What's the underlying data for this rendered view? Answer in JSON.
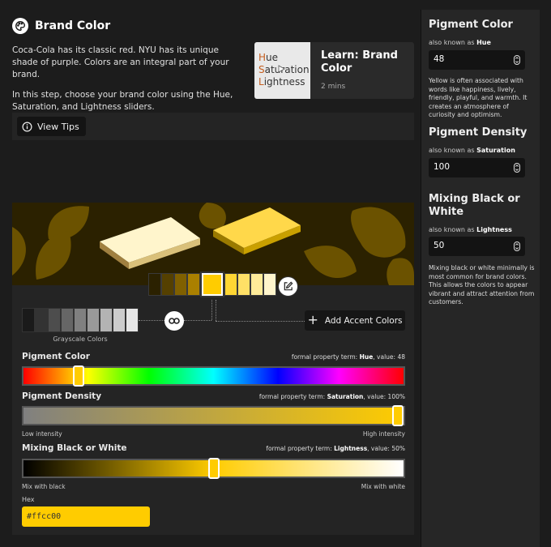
{
  "header": {
    "title": "Brand Color",
    "logo_icon": "palette-icon"
  },
  "intro": {
    "paragraph1": "Coca-Cola has its classic red. NYU has its unique shade of purple. Colors are an integral part of your brand.",
    "paragraph2": "In this step, choose your brand color using the Hue, Saturation, and Lightness sliders."
  },
  "learn_card": {
    "thumb_hue": "Hue",
    "thumb_saturation": "Saturation",
    "thumb_lightness": "Lightness",
    "title": "Learn: Brand Color",
    "duration": "2 mins"
  },
  "tips": {
    "label": "View Tips",
    "icon": "info-icon"
  },
  "colors": {
    "brand": "#ffcc00",
    "banner_bg": "#2b2100",
    "leaf": "#6b5200",
    "shade_swatches": [
      "#2b2100",
      "#554000",
      "#806000",
      "#aa8000",
      "#ffcc00",
      "#ffd633",
      "#ffe066",
      "#ffeb99",
      "#fff5cc"
    ],
    "selected_swatch_index": 4,
    "gray_swatches": [
      "#1a1a1a",
      "#333333",
      "#4d4d4d",
      "#666666",
      "#808080",
      "#999999",
      "#b3b3b3",
      "#cccccc",
      "#e6e6e6"
    ]
  },
  "grayscale_label": "Grayscale Colors",
  "accent_button": {
    "label": "Add Accent Colors"
  },
  "sliders": {
    "hue": {
      "name": "Pigment Color",
      "term_prefix": "formal property term: ",
      "term": "Hue",
      "value_text": ", value: 48",
      "value": 48,
      "max": 360
    },
    "saturation": {
      "name": "Pigment Density",
      "term_prefix": "formal property term: ",
      "term": "Saturation",
      "value_text": ", value: 100%",
      "value": 100,
      "max": 100,
      "low_label": "Low intensity",
      "high_label": "High intensity"
    },
    "lightness": {
      "name": "Mixing Black or White",
      "term_prefix": "formal property term: ",
      "term": "Lightness",
      "value_text": ", value: 50%",
      "value": 50,
      "max": 100,
      "low_label": "Mix with black",
      "high_label": "Mix with white"
    }
  },
  "hex": {
    "label": "Hex",
    "value": "#ffcc00"
  },
  "sidebar": {
    "hue": {
      "title": "Pigment Color",
      "aka_prefix": "also known as ",
      "aka": "Hue",
      "value": "48",
      "desc": "Yellow is often associated with words like happiness, lively, friendly, playful, and warmth. It creates an atmosphere of curiosity and optimism."
    },
    "saturation": {
      "title": "Pigment Density",
      "aka_prefix": "also known as ",
      "aka": "Saturation",
      "value": "100"
    },
    "lightness": {
      "title": "Mixing Black or White",
      "aka_prefix": "also known as ",
      "aka": "Lightness",
      "value": "50",
      "desc": "Mixing black or white minimally is most common for brand colors. This allows the colors to appear vibrant and attract attention from customers."
    }
  }
}
